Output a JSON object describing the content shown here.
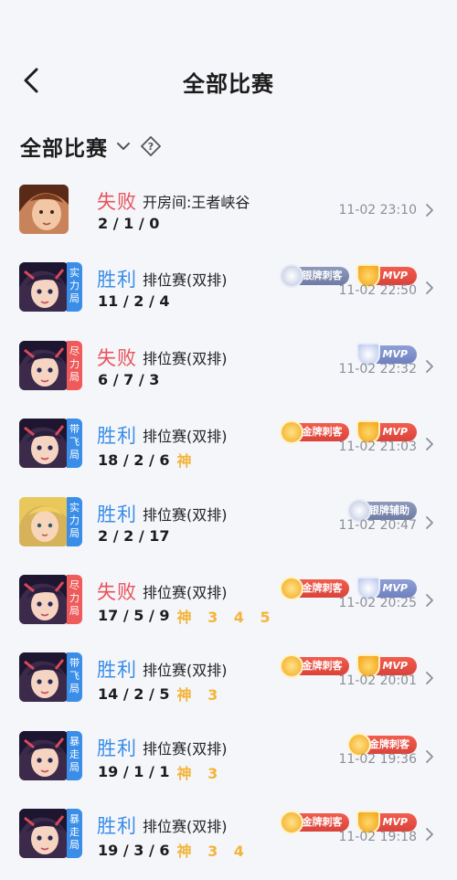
{
  "nav": {
    "title": "全部比赛"
  },
  "filter": {
    "label": "全部比赛"
  },
  "matches": [
    {
      "result": "失败",
      "outcome": "loss",
      "mode": "开房间:王者峡谷",
      "kda": "2 / 1 / 0",
      "extra": "",
      "tag": [],
      "tag_color": "",
      "badges": [],
      "time": "11-02 23:10",
      "avatar": "hero-a"
    },
    {
      "result": "胜利",
      "outcome": "win",
      "mode": "排位赛(双排)",
      "kda": "11 / 2 / 4",
      "extra": "",
      "tag": [
        "实",
        "力",
        "局"
      ],
      "tag_color": "blue",
      "badges": [
        {
          "style": "silver",
          "label": "银牌刺客"
        },
        {
          "style": "mvp-gold",
          "label": "MVP"
        }
      ],
      "time": "11-02 22:50",
      "avatar": "hero-b"
    },
    {
      "result": "失败",
      "outcome": "loss",
      "mode": "排位赛(双排)",
      "kda": "6 / 7 / 3",
      "extra": "",
      "tag": [
        "尽",
        "力",
        "局"
      ],
      "tag_color": "red",
      "badges": [
        {
          "style": "mvp-silver",
          "label": "MVP"
        }
      ],
      "time": "11-02 22:32",
      "avatar": "hero-b"
    },
    {
      "result": "胜利",
      "outcome": "win",
      "mode": "排位赛(双排)",
      "kda": "18 / 2 / 6",
      "extra": "神",
      "tag": [
        "带",
        "飞",
        "局"
      ],
      "tag_color": "blue",
      "badges": [
        {
          "style": "gold",
          "label": "金牌刺客"
        },
        {
          "style": "mvp-gold",
          "label": "MVP"
        }
      ],
      "time": "11-02 21:03",
      "avatar": "hero-b"
    },
    {
      "result": "胜利",
      "outcome": "win",
      "mode": "排位赛(双排)",
      "kda": "2 / 2 / 17",
      "extra": "",
      "tag": [
        "实",
        "力",
        "局"
      ],
      "tag_color": "blue",
      "badges": [
        {
          "style": "silver",
          "label": "银牌辅助"
        }
      ],
      "time": "11-02 20:47",
      "avatar": "hero-c"
    },
    {
      "result": "失败",
      "outcome": "loss",
      "mode": "排位赛(双排)",
      "kda": "17 / 5 / 9",
      "extra": "神 3 4 5",
      "tag": [
        "尽",
        "力",
        "局"
      ],
      "tag_color": "red",
      "badges": [
        {
          "style": "gold",
          "label": "金牌刺客"
        },
        {
          "style": "mvp-silver",
          "label": "MVP"
        }
      ],
      "time": "11-02 20:25",
      "avatar": "hero-b"
    },
    {
      "result": "胜利",
      "outcome": "win",
      "mode": "排位赛(双排)",
      "kda": "14 / 2 / 5",
      "extra": "神 3",
      "tag": [
        "带",
        "飞",
        "局"
      ],
      "tag_color": "blue",
      "badges": [
        {
          "style": "gold",
          "label": "金牌刺客"
        },
        {
          "style": "mvp-gold",
          "label": "MVP"
        }
      ],
      "time": "11-02 20:01",
      "avatar": "hero-b"
    },
    {
      "result": "胜利",
      "outcome": "win",
      "mode": "排位赛(双排)",
      "kda": "19 / 1 / 1",
      "extra": "神 3",
      "tag": [
        "暴",
        "走",
        "局"
      ],
      "tag_color": "blue",
      "badges": [
        {
          "style": "gold",
          "label": "金牌刺客"
        }
      ],
      "time": "11-02 19:36",
      "avatar": "hero-b"
    },
    {
      "result": "胜利",
      "outcome": "win",
      "mode": "排位赛(双排)",
      "kda": "19 / 3 / 6",
      "extra": "神 3 4",
      "tag": [
        "暴",
        "走",
        "局"
      ],
      "tag_color": "blue",
      "badges": [
        {
          "style": "gold",
          "label": "金牌刺客"
        },
        {
          "style": "mvp-gold",
          "label": "MVP"
        }
      ],
      "time": "11-02 19:18",
      "avatar": "hero-b"
    }
  ]
}
